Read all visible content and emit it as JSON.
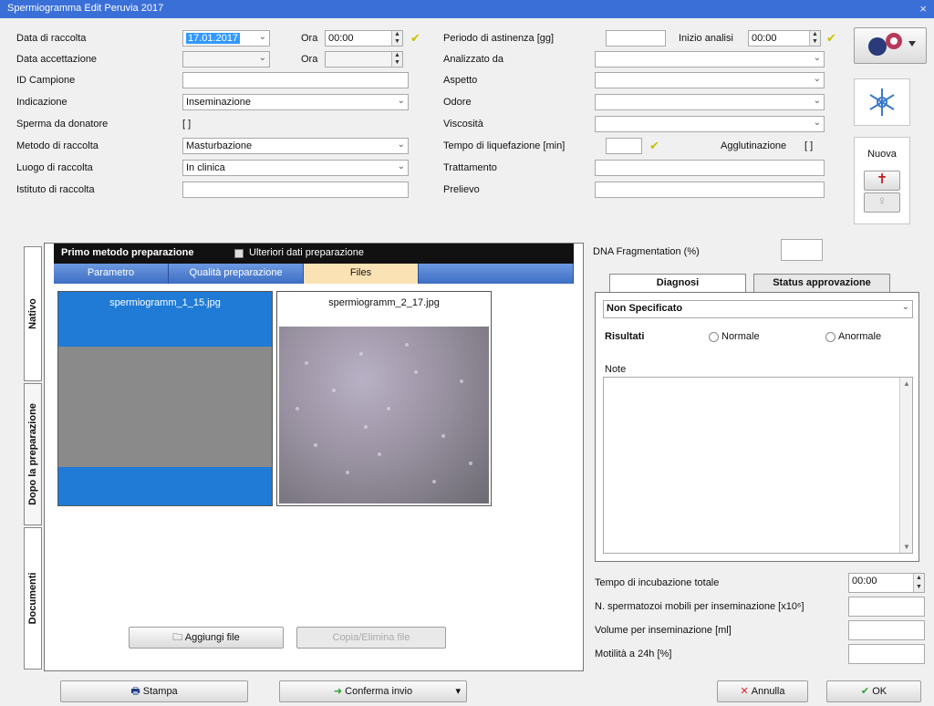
{
  "window": {
    "title": "Spermiogramma Edit  Peruvia 2017",
    "close": "×"
  },
  "form_left": {
    "rows": [
      {
        "label": "Data di raccolta",
        "value": "17.01.2017",
        "ora_label": "Ora",
        "ora_value": "00:00"
      },
      {
        "label": "Data accettazione",
        "value": "",
        "ora_label": "Ora",
        "ora_value": ""
      },
      {
        "label": "ID Campione",
        "value": ""
      },
      {
        "label": "Indicazione",
        "value": "Inseminazione"
      },
      {
        "label": "Sperma da donatore",
        "value": "[ ]"
      },
      {
        "label": "Metodo di raccolta",
        "value": "Masturbazione"
      },
      {
        "label": "Luogo di raccolta",
        "value": "In clinica"
      },
      {
        "label": "Istituto di raccolta",
        "value": ""
      }
    ]
  },
  "form_mid": {
    "rows": [
      {
        "label": "Periodo di astinenza [gg]",
        "value": ""
      },
      {
        "label": "Analizzato da",
        "value": ""
      },
      {
        "label": "Aspetto",
        "value": ""
      },
      {
        "label": "Odore",
        "value": ""
      },
      {
        "label": "Viscosità",
        "value": ""
      },
      {
        "label": "Tempo di liquefazione [min]",
        "value": ""
      },
      {
        "label": "Trattamento",
        "value": ""
      },
      {
        "label": "Prelievo",
        "value": ""
      }
    ],
    "inizio_label": "Inizio analisi",
    "inizio_value": "00:00",
    "agglutinazione_label": "Agglutinazione",
    "agglutinazione_value": "[ ]"
  },
  "side_buttons": {
    "group_label": "Nuova"
  },
  "vertical_tabs": [
    "Nativo",
    "Dopo la preparazione",
    "Documenti"
  ],
  "panel": {
    "header_left": "Primo metodo preparazione",
    "header_right": "Ulteriori dati preparazione",
    "tabs": [
      "Parametro",
      "Qualità preparazione",
      "Files"
    ],
    "active_tab": 2,
    "files": [
      {
        "name": "spermiogramm_1_15.jpg"
      },
      {
        "name": "spermiogramm_2_17.jpg"
      }
    ],
    "add_button": "Aggiungi file",
    "apply_button": "Copia/Elimina file"
  },
  "right": {
    "dna_label": "DNA Fragmentation (%)",
    "dna_value": "",
    "tabs": [
      "Diagnosi",
      "Status approvazione"
    ],
    "diagnosis_select": "Non Specificato",
    "result_label": "Risultati",
    "radio_normal": "Normale",
    "radio_abnormal": "Anormale",
    "notes_label": "Note",
    "notes_value": ""
  },
  "bottom_fields": [
    {
      "label": "Tempo di incubazione totale",
      "value": "00:00"
    },
    {
      "label": "N. spermatozoi mobili per inseminazione [x10⁶]",
      "value": ""
    },
    {
      "label": "Volume per inseminazione [ml]",
      "value": ""
    },
    {
      "label": "Motilità a 24h [%]",
      "value": ""
    }
  ],
  "footer": {
    "print_button": "Stampa",
    "commit_button": "Conferma invio",
    "cancel_button": "Annulla",
    "ok_button": "OK"
  }
}
